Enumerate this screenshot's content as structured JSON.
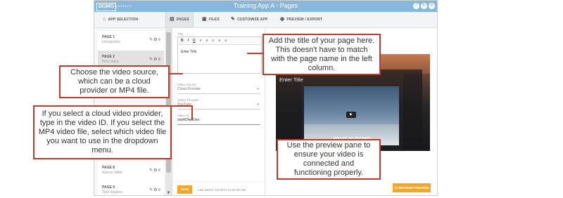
{
  "window": {
    "logo": "DOMO",
    "logo_sub": "UNIVERSITY",
    "title": "Training App A - Pages",
    "buttons": [
      "?",
      "↻",
      "✕"
    ]
  },
  "nav": {
    "items": [
      {
        "label": "APP SELECTION",
        "icon": "home-icon",
        "active": false
      },
      {
        "label": "PAGES",
        "icon": "pages-icon",
        "active": true
      },
      {
        "label": "FILES",
        "icon": "image-icon",
        "active": false
      },
      {
        "label": "CUSTOMIZE APP",
        "icon": "pencil-icon",
        "active": false
      },
      {
        "label": "PREVIEW / EXPORT",
        "icon": "eye-icon",
        "active": false
      }
    ]
  },
  "sidebar": {
    "pages": [
      {
        "title": "PAGE 1",
        "subtitle": "Introduction",
        "selected": false
      },
      {
        "title": "PAGE 2",
        "subtitle": "Intro video",
        "selected": true
      },
      {
        "title": "PAGE 8",
        "subtitle": "Survey slider",
        "selected": false
      },
      {
        "title": "PAGE 9",
        "subtitle": "Task squares",
        "selected": false
      }
    ]
  },
  "editor": {
    "title_label": "Title",
    "toolbar": [
      "B",
      "I",
      "U",
      "≡",
      "≡",
      "≡",
      "≡",
      "≡"
    ],
    "title_value": "Enter Title",
    "video_source_label": "Video Source",
    "video_source_value": "Cloud Provider",
    "video_provider_label": "Select Provider",
    "video_provider_value": "YouTube",
    "video_id_label": "Video Id",
    "video_id_value": "ovb4Dfw0Des",
    "save_label": "SAVE",
    "last_saved": "Last saved: 11/10/17 11:02:30 AM"
  },
  "preview": {
    "title": "Enter Title",
    "video_caption": "WHAT IS DOMO",
    "refresh_label": "REFRESH PREVIEW"
  },
  "callouts": {
    "title": "Add the title of your page here. This doesn't have to match with the page name in the left column.",
    "source": "Choose the video source, which can be a cloud provider or MP4 file.",
    "video_id": "If you select a cloud video provider, type in the video ID. If you select the MP4 video file, select which video file you want to use in the dropdown menu.",
    "preview": "Use the preview pane to ensure your video is connected and functioning properly."
  }
}
